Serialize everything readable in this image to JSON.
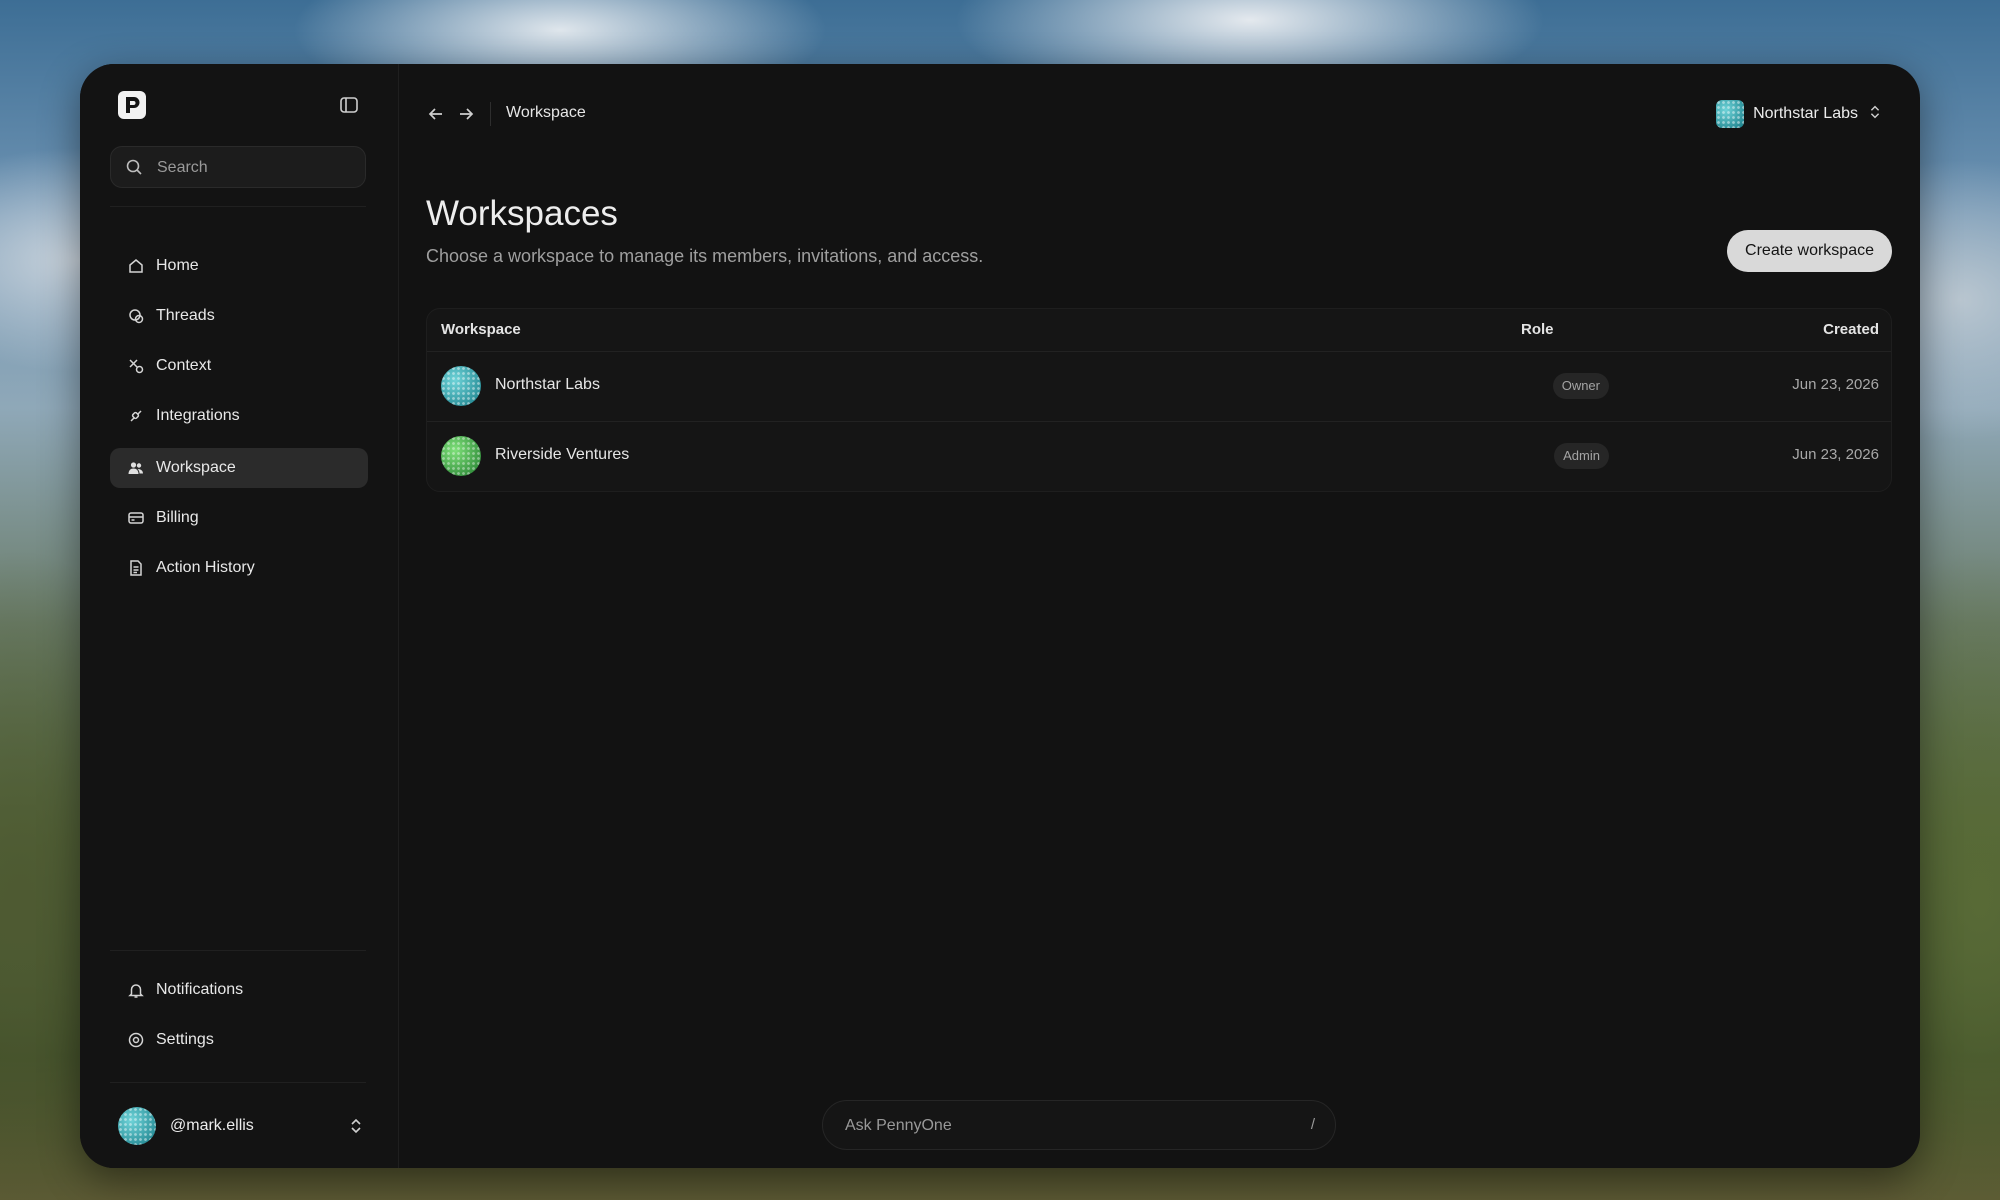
{
  "sidebar": {
    "search_placeholder": "Search",
    "nav": [
      {
        "label": "Home",
        "icon": "home-icon"
      },
      {
        "label": "Threads",
        "icon": "threads-icon"
      },
      {
        "label": "Context",
        "icon": "context-icon"
      },
      {
        "label": "Integrations",
        "icon": "integrations-icon"
      },
      {
        "label": "Workspace",
        "icon": "users-icon",
        "active": true
      },
      {
        "label": "Billing",
        "icon": "credit-card-icon"
      },
      {
        "label": "Action History",
        "icon": "document-icon"
      }
    ],
    "bottom_nav": [
      {
        "label": "Notifications",
        "icon": "bell-icon"
      },
      {
        "label": "Settings",
        "icon": "gear-icon"
      }
    ],
    "user": {
      "handle": "@mark.ellis"
    }
  },
  "topbar": {
    "breadcrumb": "Workspace",
    "workspace_switcher": "Northstar Labs"
  },
  "main": {
    "title": "Workspaces",
    "subtitle": "Choose a workspace to manage its members, invitations, and access.",
    "create_button": "Create workspace",
    "table": {
      "columns": [
        "Workspace",
        "Role",
        "Created"
      ],
      "rows": [
        {
          "name": "Northstar Labs",
          "role": "Owner",
          "created": "Jun 23, 2026"
        },
        {
          "name": "Riverside Ventures",
          "role": "Admin",
          "created": "Jun 23, 2026"
        }
      ]
    }
  },
  "ask": {
    "placeholder": "Ask PennyOne",
    "shortcut": "/"
  },
  "colors": {
    "window_bg": "#121212",
    "active_nav": "#2b2b2b",
    "button_bg": "#d9d9d9"
  }
}
